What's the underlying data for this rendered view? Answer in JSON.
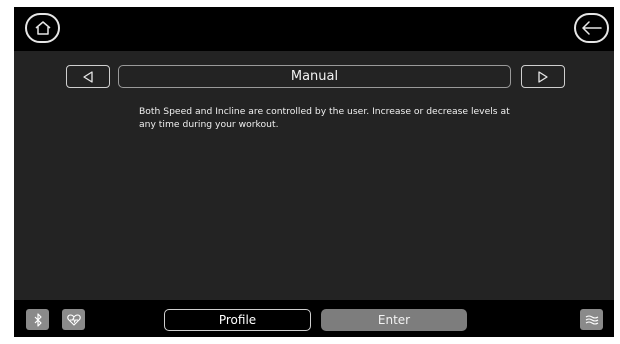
{
  "program": {
    "title": "Manual",
    "description": "Both Speed and Incline are controlled by the user. Increase or decrease levels at any time during your workout."
  },
  "buttons": {
    "profile": "Profile",
    "enter": "Enter"
  },
  "icons": {
    "home": "home-icon",
    "back": "back-arrow-icon",
    "prev": "triangle-left-icon",
    "next": "triangle-right-icon",
    "bluetooth": "bluetooth-icon",
    "heart_rate": "heart-rate-icon",
    "fan": "fan-icon"
  },
  "colors": {
    "screen_bg": "#232323",
    "bar_bg": "#000000",
    "enter_bg": "#7d7d7d",
    "square_btn_bg": "#8a8a8a"
  }
}
